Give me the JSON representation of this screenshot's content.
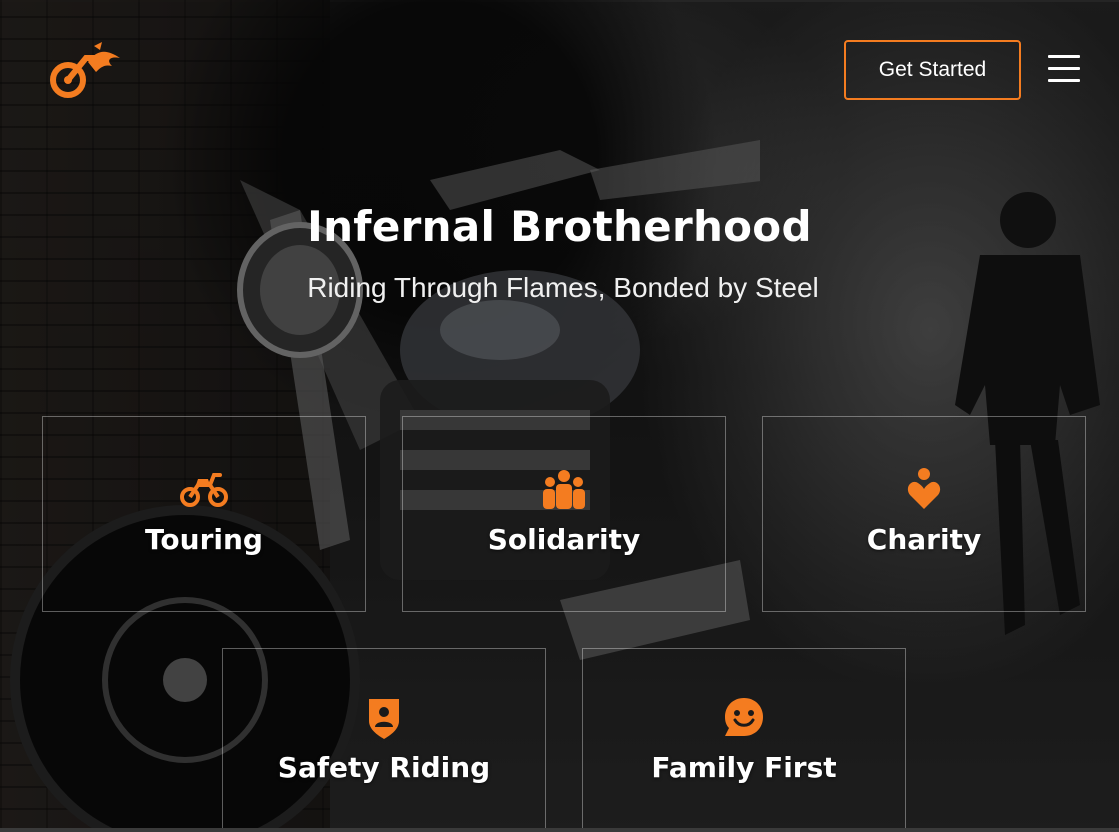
{
  "header": {
    "logo_icon": "motorcycle-flame-logo-icon",
    "cta_label": "Get Started",
    "menu_icon": "hamburger-menu-icon"
  },
  "hero": {
    "title": "Infernal Brotherhood",
    "subtitle": "Riding Through Flames, Bonded by Steel"
  },
  "features": [
    {
      "label": "Touring",
      "icon": "motorcycle-icon"
    },
    {
      "label": "Solidarity",
      "icon": "group-icon"
    },
    {
      "label": "Charity",
      "icon": "person-heart-icon"
    },
    {
      "label": "Safety Riding",
      "icon": "shield-person-icon"
    },
    {
      "label": "Family First",
      "icon": "smile-chat-icon"
    }
  ],
  "colors": {
    "accent": "#f47c20",
    "text": "#ffffff"
  }
}
